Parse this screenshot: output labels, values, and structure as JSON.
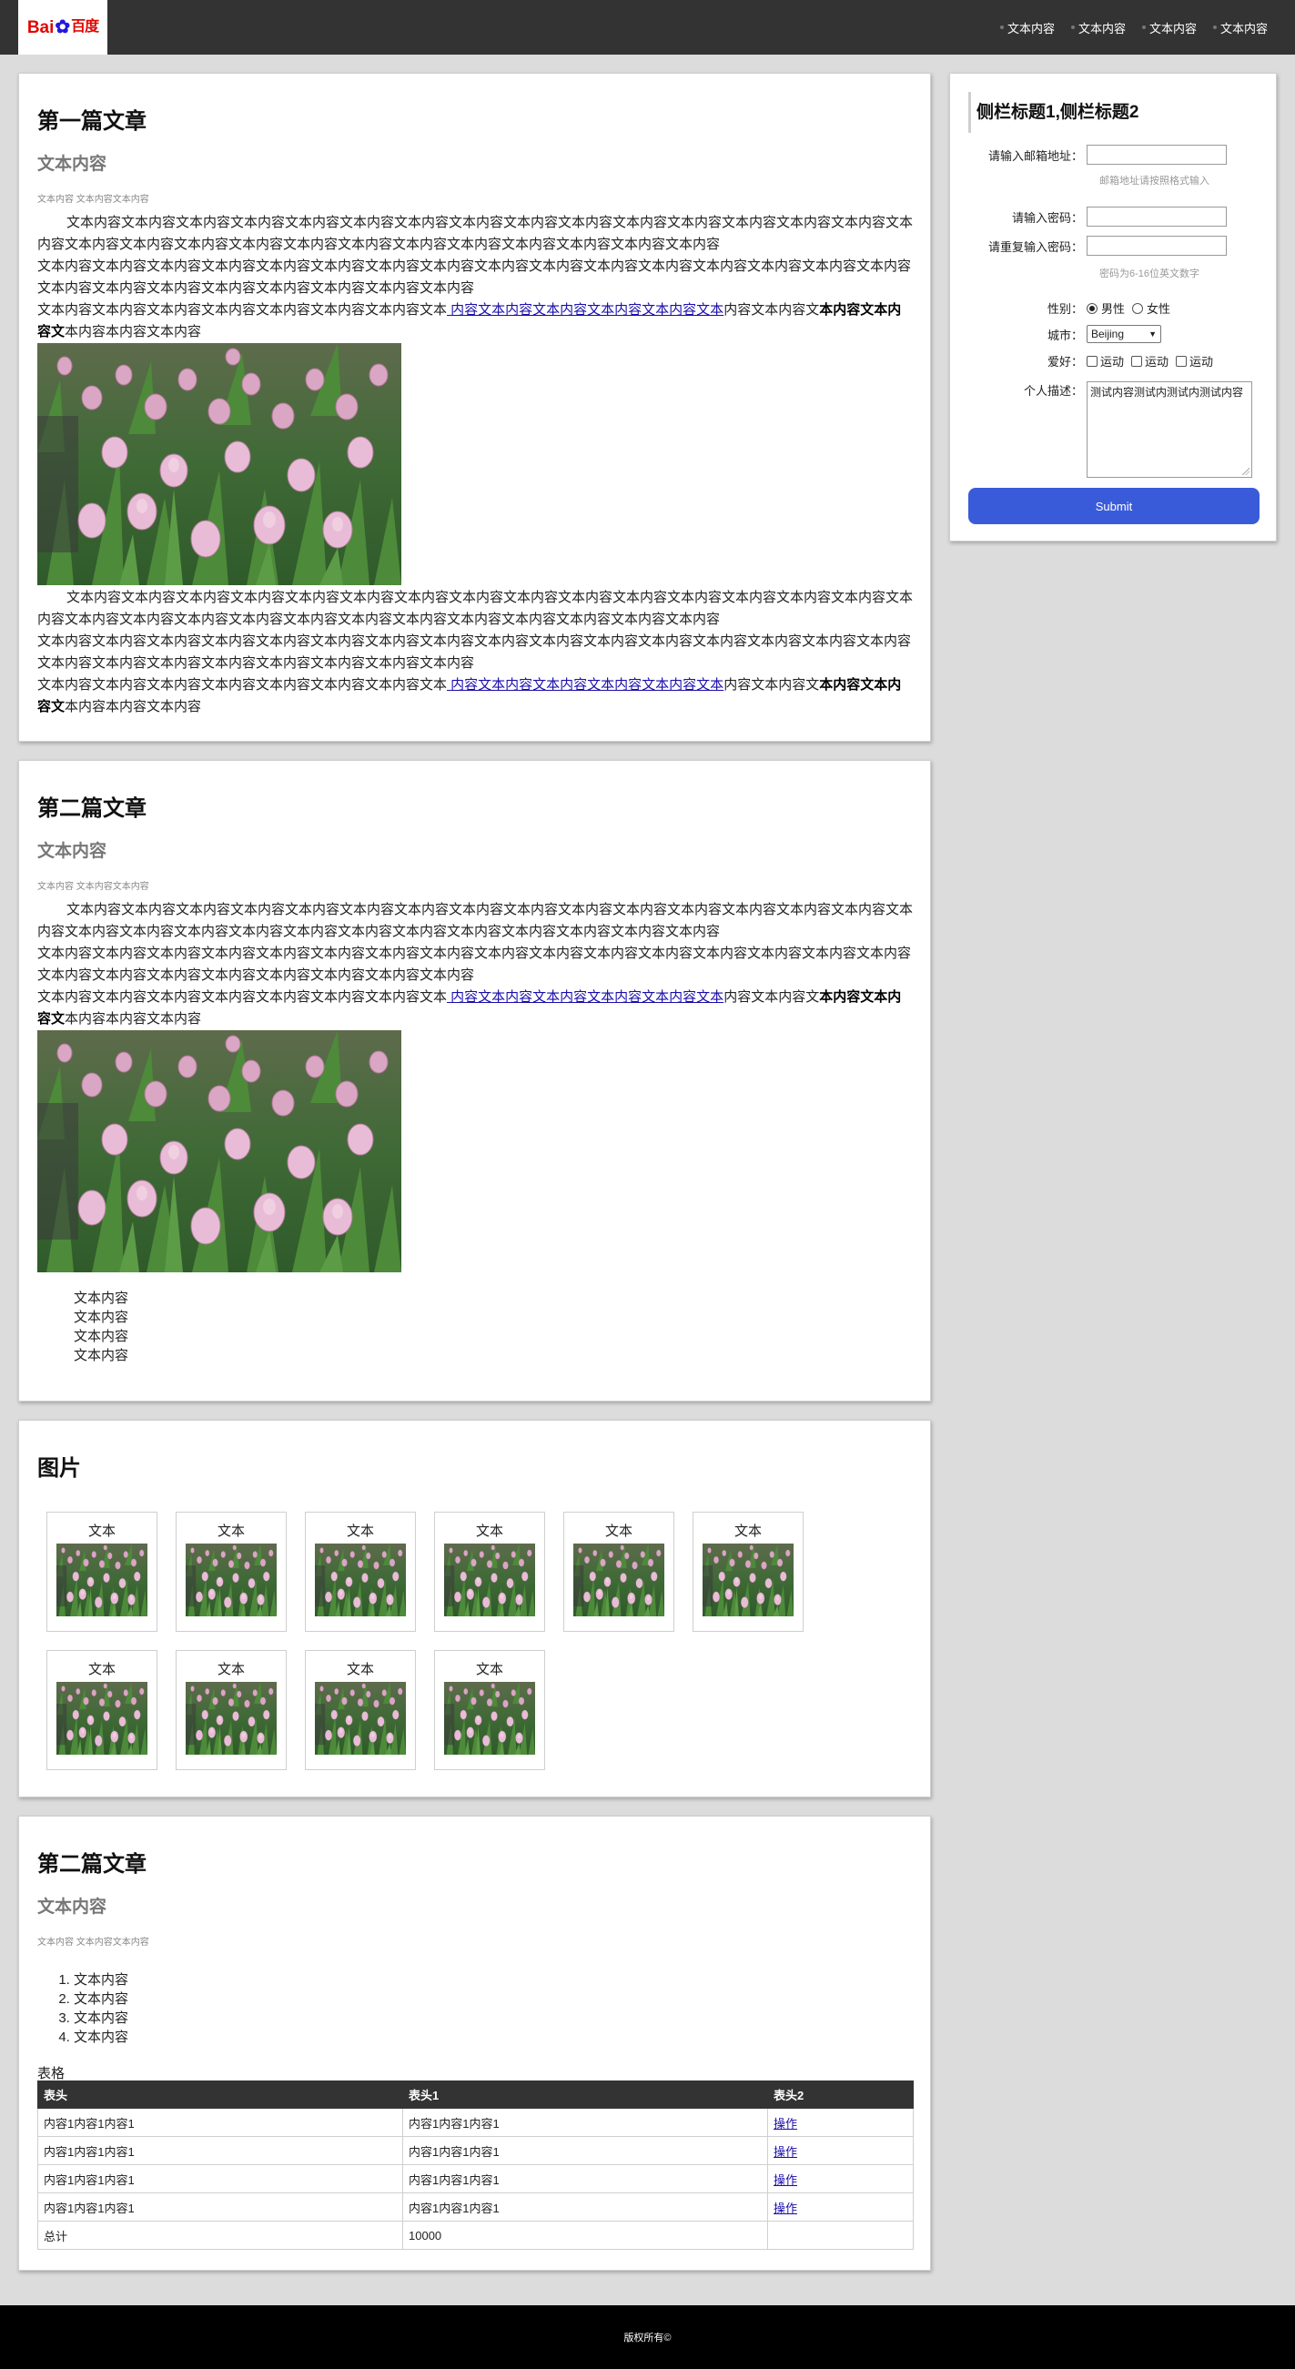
{
  "header": {
    "logo": {
      "part1": "Bai",
      "part2": "百度"
    },
    "nav": [
      "文本内容",
      "文本内容",
      "文本内容",
      "文本内容"
    ]
  },
  "article1": {
    "title": "第一篇文章",
    "subtitle": "文本内容",
    "meta": "文本内容 文本内容文本内容",
    "p1": "文本内容文本内容文本内容文本内容文本内容文本内容文本内容文本内容文本内容文本内容文本内容文本内容文本内容文本内容文本内容文本内容文本内容文本内容文本内容文本内容文本内容文本内容文本内容文本内容文本内容文本内容文本内容文本内容",
    "p2": "文本内容文本内容文本内容文本内容文本内容文本内容文本内容文本内容文本内容文本内容文本内容文本内容文本内容文本内容文本内容文本内容文本内容文本内容文本内容文本内容文本内容文本内容文本内容文本内容",
    "p3_start": "文本内容文本内容文本内容文本内容文本内容文本内容文本内容文本",
    "p3_link": " 内容文本内容文本内容文本内容文本内容文本",
    "p3_mid": "内容文本内容文",
    "p3_bold": "本内容文本内容文",
    "p3_end": "本内容本内容文本内容",
    "p4": "文本内容文本内容文本内容文本内容文本内容文本内容文本内容文本内容文本内容文本内容文本内容文本内容文本内容文本内容文本内容文本内容文本内容文本内容文本内容文本内容文本内容文本内容文本内容文本内容文本内容文本内容文本内容文本内容",
    "p5": "文本内容文本内容文本内容文本内容文本内容文本内容文本内容文本内容文本内容文本内容文本内容文本内容文本内容文本内容文本内容文本内容文本内容文本内容文本内容文本内容文本内容文本内容文本内容文本内容",
    "p6_start": "文本内容文本内容文本内容文本内容文本内容文本内容文本内容文本",
    "p6_link": " 内容文本内容文本内容文本内容文本内容文本",
    "p6_mid": "内容文本内容文",
    "p6_bold": "本内容文本内容文",
    "p6_end": "本内容本内容文本内容"
  },
  "article2": {
    "title": "第二篇文章",
    "subtitle": "文本内容",
    "meta": "文本内容 文本内容文本内容",
    "p1": "文本内容文本内容文本内容文本内容文本内容文本内容文本内容文本内容文本内容文本内容文本内容文本内容文本内容文本内容文本内容文本内容文本内容文本内容文本内容文本内容文本内容文本内容文本内容文本内容文本内容文本内容文本内容文本内容",
    "p2": "文本内容文本内容文本内容文本内容文本内容文本内容文本内容文本内容文本内容文本内容文本内容文本内容文本内容文本内容文本内容文本内容文本内容文本内容文本内容文本内容文本内容文本内容文本内容文本内容",
    "p3_start": "文本内容文本内容文本内容文本内容文本内容文本内容文本内容文本",
    "p3_link": " 内容文本内容文本内容文本内容文本内容文本",
    "p3_mid": "内容文本内容文",
    "p3_bold": "本内容文本内容文",
    "p3_end": "本内容本内容文本内容",
    "list": [
      "文本内容",
      "文本内容",
      "文本内容",
      "文本内容"
    ]
  },
  "gallery": {
    "title": "图片",
    "items": [
      "文本",
      "文本",
      "文本",
      "文本",
      "文本",
      "文本",
      "文本",
      "文本",
      "文本",
      "文本"
    ]
  },
  "article3": {
    "title": "第二篇文章",
    "subtitle": "文本内容",
    "meta": "文本内容 文本内容文本内容",
    "list": [
      "文本内容",
      "文本内容",
      "文本内容",
      "文本内容"
    ],
    "table_caption": "表格",
    "table_headers": [
      "表头",
      "表头1",
      "表头2"
    ],
    "table_rows": [
      [
        "内容1内容1内容1",
        "内容1内容1内容1",
        "操作"
      ],
      [
        "内容1内容1内容1",
        "内容1内容1内容1",
        "操作"
      ],
      [
        "内容1内容1内容1",
        "内容1内容1内容1",
        "操作"
      ],
      [
        "内容1内容1内容1",
        "内容1内容1内容1",
        "操作"
      ]
    ],
    "table_total": [
      "总计",
      "10000",
      ""
    ]
  },
  "sidebar": {
    "title": "侧栏标题1,侧栏标题2",
    "email_label": "请输入邮箱地址：",
    "email_hint": "邮箱地址请按照格式输入",
    "password_label": "请输入密码：",
    "password2_label": "请重复输入密码：",
    "password_hint": "密码为6-16位英文数字",
    "gender_label": "性别：",
    "gender_options": [
      "男性",
      "女性"
    ],
    "gender_selected": "男性",
    "city_label": "城市：",
    "city_value": "Beijing",
    "hobby_label": "爱好：",
    "hobby_options": [
      "运动",
      "运动",
      "运动"
    ],
    "desc_label": "个人描述：",
    "desc_value": "测试内容测试内测试内测试内容",
    "submit_label": "Submit"
  },
  "footer": {
    "text": "版权所有©"
  },
  "colors": {
    "header_bg": "#333333",
    "submit_bg": "#3a5bd9",
    "page_bg": "#dcdcdc",
    "footer_bg": "#000000",
    "link": "#1a0dab"
  }
}
